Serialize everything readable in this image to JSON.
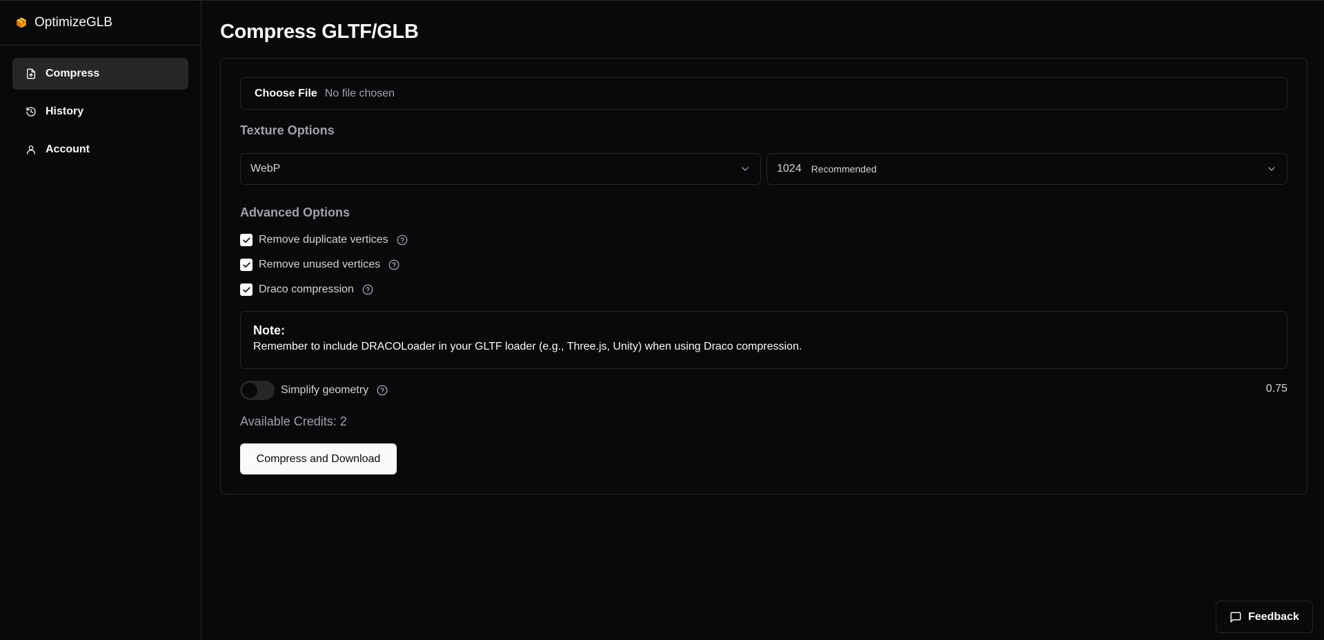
{
  "brand": {
    "name": "OptimizeGLB",
    "icon": "package-icon"
  },
  "sidebar": {
    "items": [
      {
        "label": "Compress",
        "icon": "file-upload-icon",
        "active": true
      },
      {
        "label": "History",
        "icon": "history-icon",
        "active": false
      },
      {
        "label": "Account",
        "icon": "user-icon",
        "active": false
      }
    ]
  },
  "page": {
    "title": "Compress GLTF/GLB"
  },
  "file_input": {
    "button_label": "Choose File",
    "status": "No file chosen"
  },
  "texture": {
    "section_label": "Texture Options",
    "format_select": {
      "value": "WebP"
    },
    "size_select": {
      "value": "1024",
      "sub_label": "Recommended"
    }
  },
  "advanced": {
    "section_label": "Advanced Options",
    "options": [
      {
        "label": "Remove duplicate vertices",
        "checked": true
      },
      {
        "label": "Remove unused vertices",
        "checked": true
      },
      {
        "label": "Draco compression",
        "checked": true
      }
    ]
  },
  "note": {
    "title": "Note:",
    "body": "Remember to include DRACOLoader in your GLTF loader (e.g., Three.js, Unity) when using Draco compression."
  },
  "simplify": {
    "label": "Simplify geometry",
    "enabled": false,
    "value": "0.75"
  },
  "credits": {
    "text": "Available Credits: 2"
  },
  "actions": {
    "compress_label": "Compress and Download"
  },
  "feedback": {
    "label": "Feedback",
    "icon": "message-square-icon"
  },
  "colors": {
    "background": "#09090b",
    "border": "#27272a",
    "foreground": "#fafafa",
    "muted": "#a1a1aa",
    "brand_icon": "#f59e0b"
  }
}
